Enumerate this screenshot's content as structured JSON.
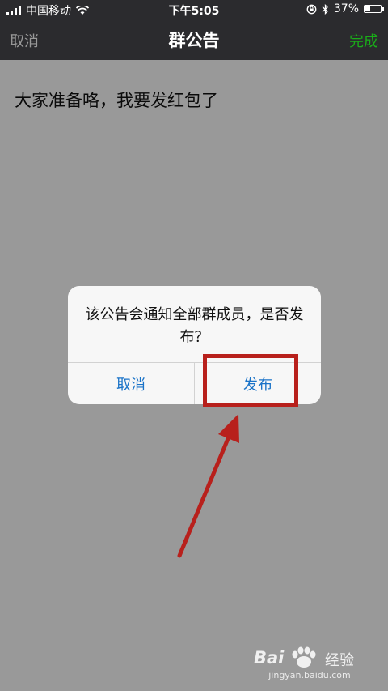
{
  "status_bar": {
    "carrier": "中国移动",
    "time": "下午5:05",
    "battery_percent": "37%",
    "battery_level": 0.37
  },
  "nav": {
    "cancel": "取消",
    "title": "群公告",
    "done": "完成",
    "done_color": "#1aad19"
  },
  "content": {
    "announcement": "大家准备咯，我要发红包了"
  },
  "alert": {
    "message": "该公告会通知全部群成员，是否发布？",
    "cancel": "取消",
    "publish": "发布",
    "button_color": "#1a73c8"
  },
  "annotation": {
    "color": "#b8201c"
  },
  "watermark": {
    "logo": "Bai",
    "logo_suffix": "经验",
    "url": "jingyan.baidu.com"
  }
}
